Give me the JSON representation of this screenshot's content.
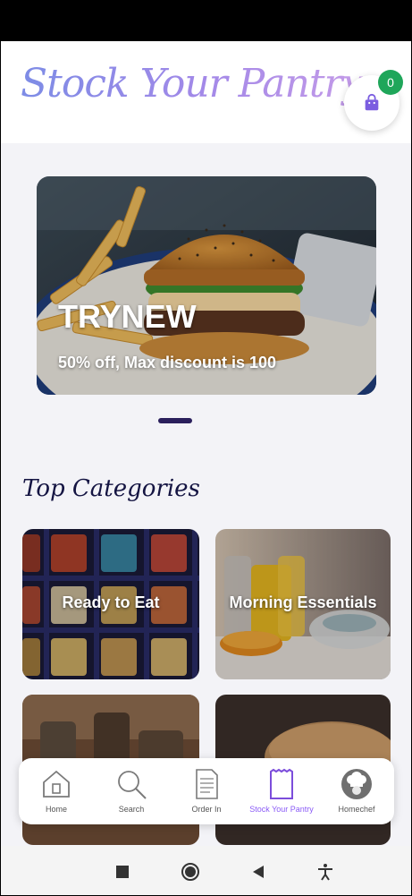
{
  "header": {
    "title": "Stock Your Pantry",
    "cart_count": "0",
    "cart_icon": "shopping-bag-icon"
  },
  "banner": {
    "title": "TRYNEW",
    "subtitle": "50% off, Max discount is 100"
  },
  "categories": {
    "title": "Top Categories",
    "items": [
      {
        "label": "Ready to Eat"
      },
      {
        "label": "Morning Essentials"
      },
      {
        "label": ""
      },
      {
        "label": ""
      }
    ]
  },
  "bottom_nav": {
    "items": [
      {
        "label": "Home",
        "icon": "home-icon"
      },
      {
        "label": "Search",
        "icon": "search-icon"
      },
      {
        "label": "Order In",
        "icon": "document-icon"
      },
      {
        "label": "Stock Your Pantry",
        "icon": "receipt-icon",
        "active": true
      },
      {
        "label": "Homechef",
        "icon": "chef-icon"
      }
    ]
  },
  "colors": {
    "accent": "#8b5cf6",
    "title_gradient_start": "#7d8ce6",
    "title_gradient_end": "#c49be8",
    "badge": "#1fa65a",
    "section_title": "#141442"
  }
}
